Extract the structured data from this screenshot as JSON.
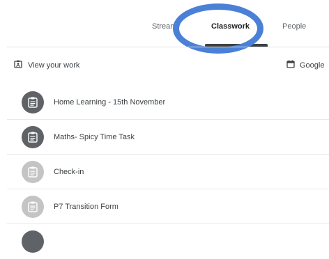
{
  "tabs": [
    {
      "label": "Stream"
    },
    {
      "label": "Classwork"
    },
    {
      "label": "People"
    }
  ],
  "toolbar": {
    "view_work_label": "View your work",
    "calendar_label": "Google"
  },
  "assignments": [
    {
      "title": "Home Learning - 15th November",
      "icon": "assignment-icon",
      "state": "active"
    },
    {
      "title": "Maths- Spicy Time Task",
      "icon": "assignment-icon",
      "state": "active"
    },
    {
      "title": "Check-in",
      "icon": "assignment-icon",
      "state": "inactive"
    },
    {
      "title": "P7 Transition Form",
      "icon": "assignment-icon",
      "state": "inactive"
    }
  ],
  "colors": {
    "highlight_ring": "#4a80d6",
    "active_badge": "#5f6368",
    "inactive_badge": "#c4c4c4"
  }
}
